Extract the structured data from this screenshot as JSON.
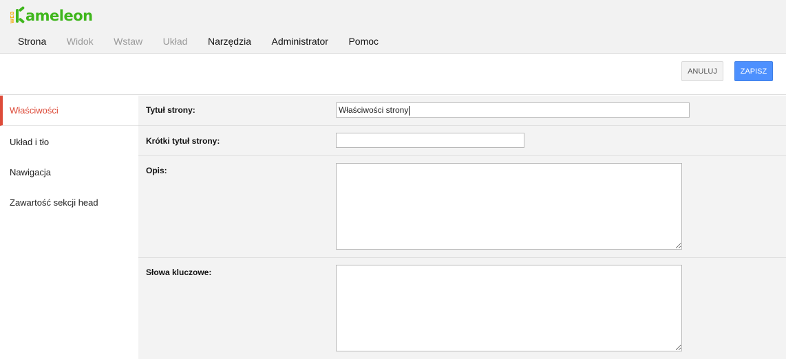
{
  "app": {
    "logo_small": "WEB",
    "logo_text": "ameleon",
    "brand_color": "#3fb61c",
    "accent_color": "#dd4b39"
  },
  "menu": [
    {
      "label": "Strona",
      "enabled": true
    },
    {
      "label": "Widok",
      "enabled": false
    },
    {
      "label": "Wstaw",
      "enabled": false
    },
    {
      "label": "Układ",
      "enabled": false
    },
    {
      "label": "Narzędzia",
      "enabled": true
    },
    {
      "label": "Administrator",
      "enabled": true
    },
    {
      "label": "Pomoc",
      "enabled": true
    }
  ],
  "actions": {
    "cancel_label": "ANULUJ",
    "save_label": "ZAPISZ"
  },
  "sidebar": {
    "items": [
      {
        "label": "Właściwości",
        "active": true
      },
      {
        "label": "Układ i tło",
        "active": false
      },
      {
        "label": "Nawigacja",
        "active": false
      },
      {
        "label": "Zawartość sekcji head",
        "active": false
      }
    ]
  },
  "form": {
    "title": {
      "label": "Tytuł strony:",
      "value": "Właściwości strony"
    },
    "short_title": {
      "label": "Krótki tytuł strony:",
      "value": ""
    },
    "description": {
      "label": "Opis:",
      "value": ""
    },
    "keywords": {
      "label": "Słowa kluczowe:",
      "value": ""
    }
  }
}
